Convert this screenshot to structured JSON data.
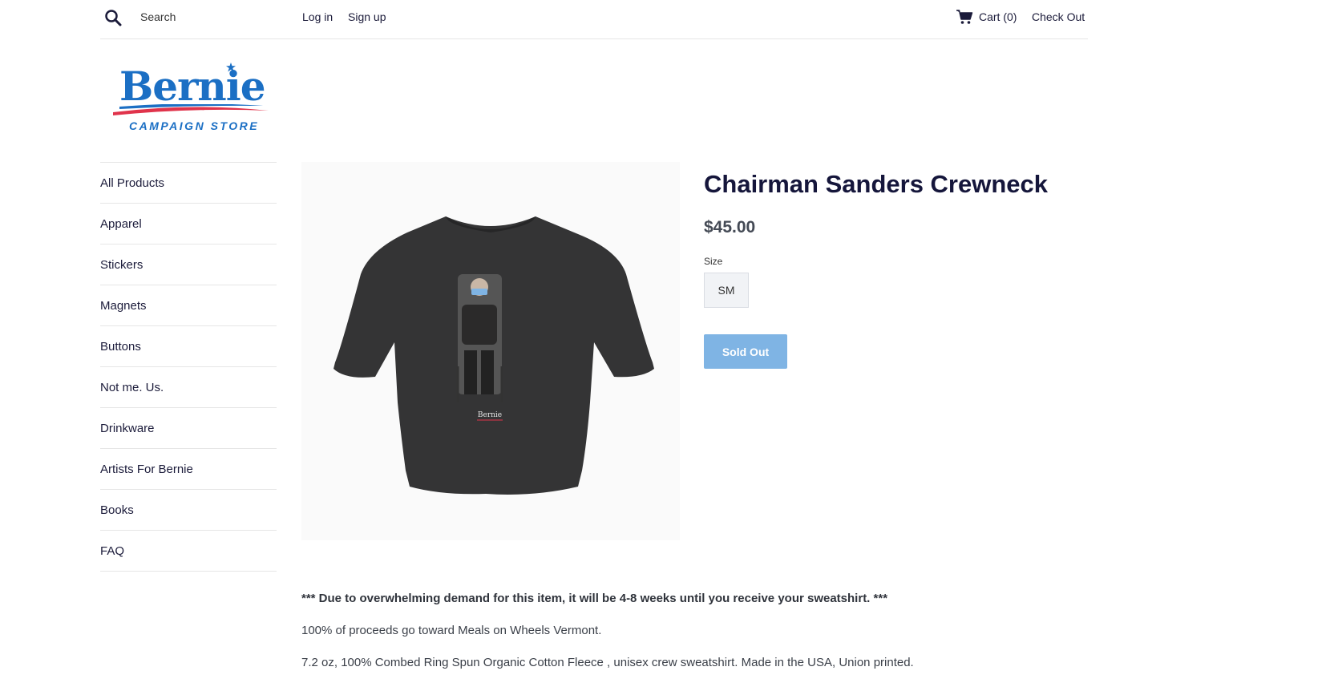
{
  "header": {
    "search_placeholder": "Search",
    "login": "Log in",
    "signup": "Sign up",
    "cart": "Cart (0)",
    "checkout": "Check Out"
  },
  "logo": {
    "word": "Bernie",
    "sub": "CAMPAIGN STORE"
  },
  "sidebar": {
    "items": [
      {
        "label": "All Products"
      },
      {
        "label": "Apparel"
      },
      {
        "label": "Stickers"
      },
      {
        "label": "Magnets"
      },
      {
        "label": "Buttons"
      },
      {
        "label": "Not me. Us."
      },
      {
        "label": "Drinkware"
      },
      {
        "label": "Artists For Bernie"
      },
      {
        "label": "Books"
      },
      {
        "label": "FAQ"
      }
    ]
  },
  "product": {
    "title": "Chairman Sanders Crewneck",
    "price": "$45.00",
    "size_label": "Size",
    "size_value": "SM",
    "button": "Sold Out",
    "image_text": "Bernie",
    "description": [
      "*** Due to overwhelming demand for this item, it will be 4-8 weeks until you receive your sweatshirt. ***",
      "100% of proceeds go toward Meals on Wheels Vermont.",
      "7.2 oz, 100% Combed Ring Spun Organic Cotton Fleece , unisex crew sweatshirt. Made in the USA, Union printed."
    ]
  },
  "colors": {
    "brand_blue": "#1b6fc4",
    "brand_red": "#e0334b",
    "title_navy": "#15163b",
    "soldout_bg": "#7fb4e4"
  }
}
